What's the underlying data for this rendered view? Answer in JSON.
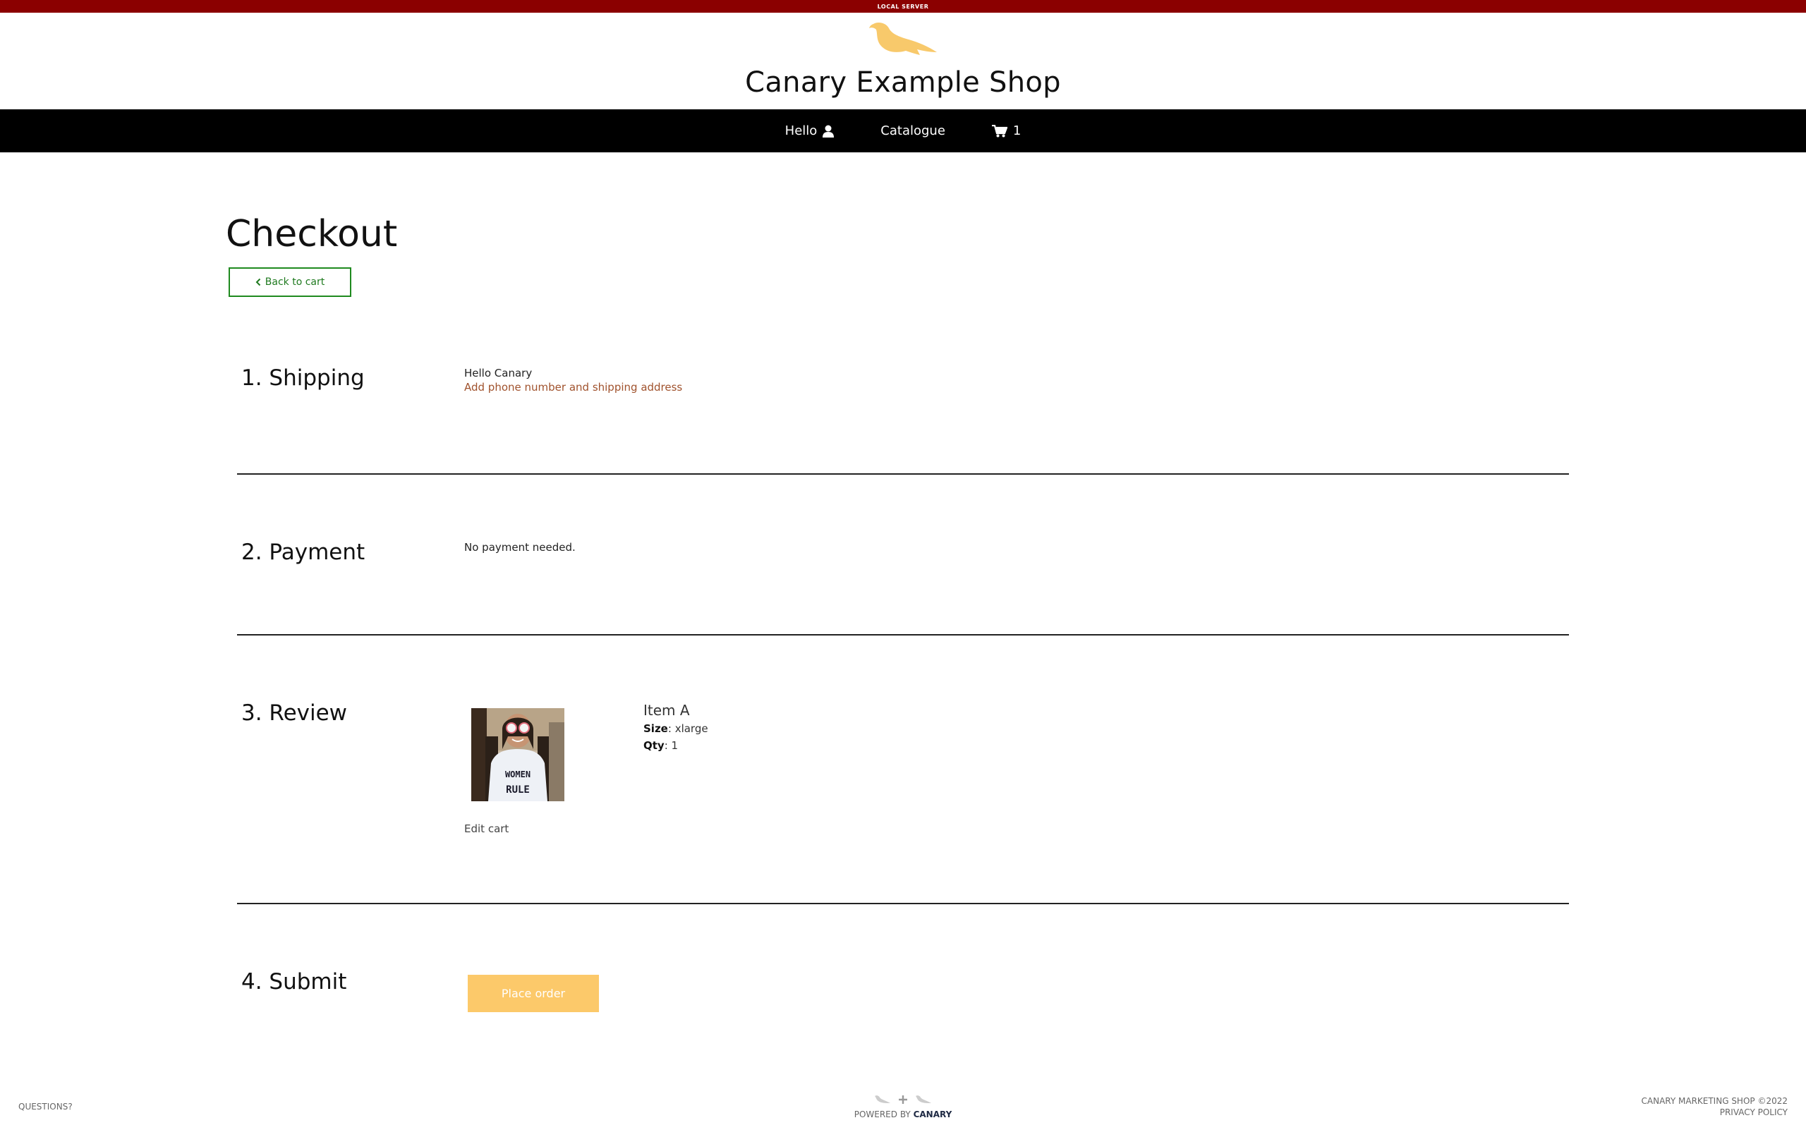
{
  "env_banner": "LOCAL SERVER",
  "header": {
    "shop_title": "Canary Example Shop"
  },
  "nav": {
    "hello": "Hello",
    "catalogue": "Catalogue",
    "cart_count": "1"
  },
  "page": {
    "title": "Checkout",
    "back_to_cart": "Back to cart"
  },
  "sections": {
    "shipping": {
      "heading": "1. Shipping",
      "greeting": "Hello Canary",
      "add_link": "Add phone number and shipping address"
    },
    "payment": {
      "heading": "2. Payment",
      "text": "No payment needed."
    },
    "review": {
      "heading": "3. Review",
      "item_name": "Item A",
      "size_label": "Size",
      "size_value": "xlarge",
      "qty_label": "Qty",
      "qty_value": "1",
      "tshirt_line1": "WOMEN",
      "tshirt_line2": "RULE",
      "edit_cart": "Edit cart"
    },
    "submit": {
      "heading": "4. Submit",
      "place_order": "Place order"
    }
  },
  "footer": {
    "questions": "QUESTIONS?",
    "powered_by": "POWERED BY",
    "powered_brand": "CANARY",
    "copyright": "CANARY MARKETING SHOP ©2022",
    "privacy": "PRIVACY POLICY"
  },
  "colors": {
    "env_bar": "#8b0000",
    "logo_bird": "#f8c96b",
    "nav_bg": "#000000",
    "back_button_border": "#1f8a1f",
    "link_orange": "#a0522d",
    "place_order_bg": "#fcc96a"
  },
  "icons": {
    "logo": "canary-bird-icon",
    "hello": "user-icon",
    "cart": "shopping-cart-icon",
    "back": "chevron-left-icon",
    "footer_plus": "plus-icon"
  }
}
